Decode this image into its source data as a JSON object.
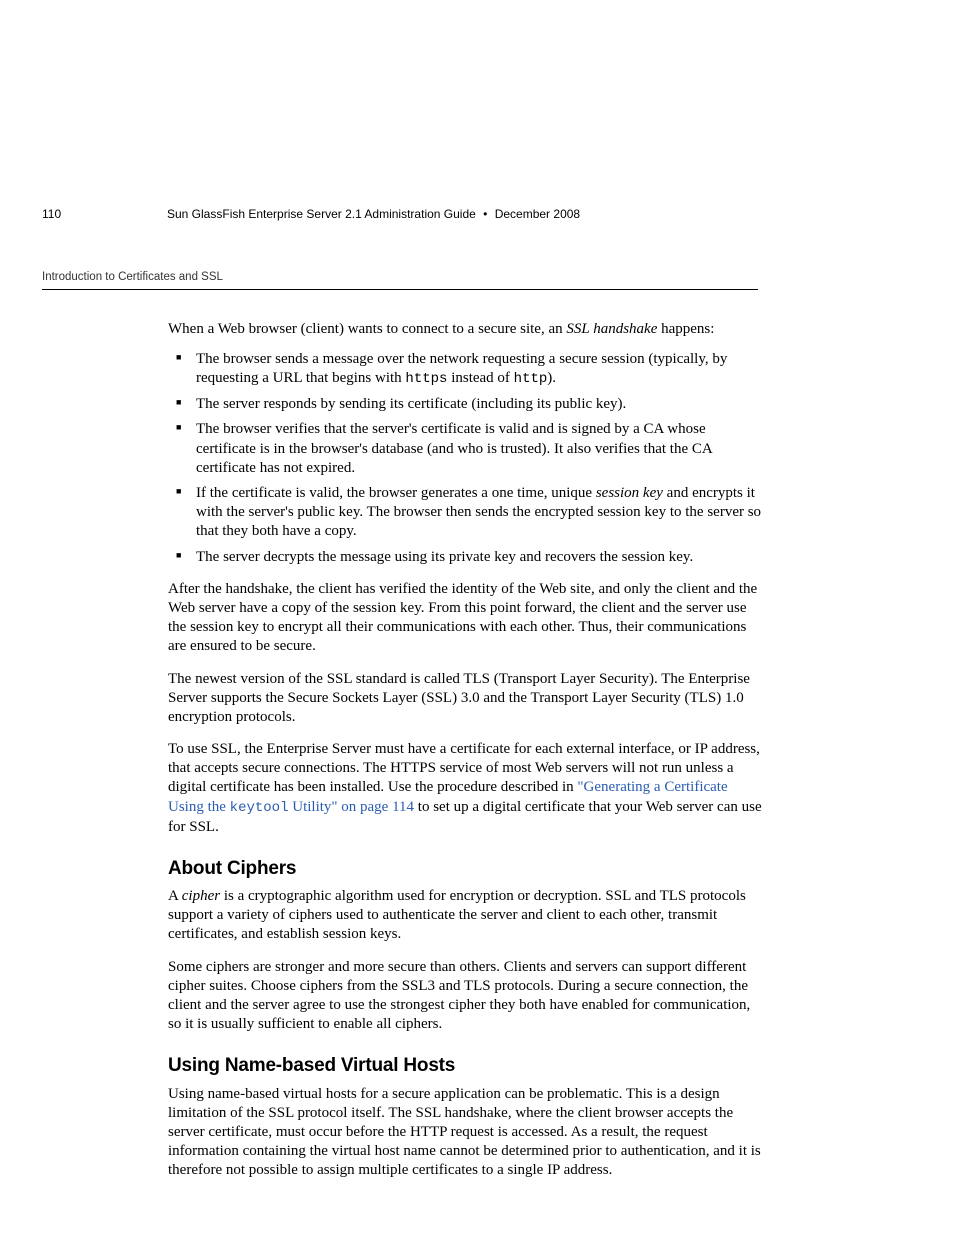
{
  "header": {
    "running_title": "Introduction to Certificates and SSL"
  },
  "body": {
    "p_intro_a": "When a Web browser (client) wants to connect to a secure site, an ",
    "p_intro_italic": "SSL handshake",
    "p_intro_b": " happens:",
    "bullets": {
      "b1a": "The browser sends a message over the network requesting a secure session (typically, by requesting a URL that begins with ",
      "b1_code1": "https",
      "b1b": " instead of ",
      "b1_code2": "http",
      "b1c": ").",
      "b2": "The server responds by sending its certificate (including its public key).",
      "b3": "The browser verifies that the server's certificate is valid and is signed by a CA whose certificate is in the browser's database (and who is trusted). It also verifies that the CA certificate has not expired.",
      "b4a": "If the certificate is valid, the browser generates a one time, unique ",
      "b4_italic": "session key",
      "b4b": " and encrypts it with the server's public key. The browser then sends the encrypted session key to the server so that they both have a copy.",
      "b5": "The server decrypts the message using its private key and recovers the session key."
    },
    "p_after1": "After the handshake, the client has verified the identity of the Web site, and only the client and the Web server have a copy of the session key. From this point forward, the client and the server use the session key to encrypt all their communications with each other. Thus, their communications are ensured to be secure.",
    "p_after2": "The newest version of the SSL standard is called TLS (Transport Layer Security). The Enterprise Server supports the Secure Sockets Layer (SSL) 3.0 and the Transport Layer Security (TLS) 1.0 encryption protocols.",
    "p_after3a": "To use SSL, the Enterprise Server must have a certificate for each external interface, or IP address, that accepts secure connections. The HTTPS service of most Web servers will not run unless a digital certificate has been installed. Use the procedure described in ",
    "p_after3_link_a": "\"Generating a Certificate Using the ",
    "p_after3_link_code": "keytool",
    "p_after3_link_b": " Utility\" on page 114",
    "p_after3b": " to set up a digital certificate that your Web server can use for SSL.",
    "h_ciphers": "About Ciphers",
    "p_ciphers1a": "A ",
    "p_ciphers1_italic": "cipher",
    "p_ciphers1b": " is a cryptographic algorithm used for encryption or decryption. SSL and TLS protocols support a variety of ciphers used to authenticate the server and client to each other, transmit certificates, and establish session keys.",
    "p_ciphers2": "Some ciphers are stronger and more secure than others. Clients and servers can support different cipher suites. Choose ciphers from the SSL3 and TLS protocols. During a secure connection, the client and the server agree to use the strongest cipher they both have enabled for communication, so it is usually sufficient to enable all ciphers.",
    "h_vhosts": "Using Name-based Virtual Hosts",
    "p_vhosts1": "Using name-based virtual hosts for a secure application can be problematic. This is a design limitation of the SSL protocol itself. The SSL handshake, where the client browser accepts the server certificate, must occur before the HTTP request is accessed. As a result, the request information containing the virtual host name cannot be determined prior to authentication, and it is therefore not possible to assign multiple certificates to a single IP address."
  },
  "footer": {
    "page_number": "110",
    "doc_title": "Sun GlassFish Enterprise Server 2.1 Administration Guide",
    "separator": "•",
    "date": "December 2008"
  }
}
